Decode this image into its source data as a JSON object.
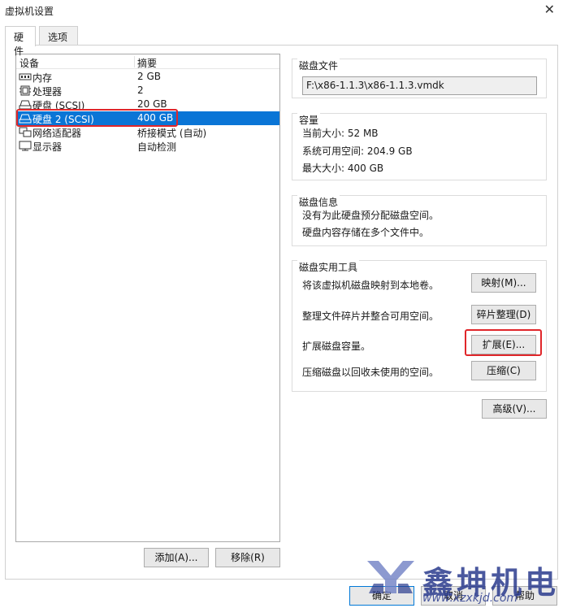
{
  "window": {
    "title": "虚拟机设置"
  },
  "tabs": [
    {
      "label": "硬件"
    },
    {
      "label": "选项"
    }
  ],
  "device_list": {
    "col_device": "设备",
    "col_summary": "摘要",
    "rows": [
      {
        "name": "内存",
        "summary": "2 GB",
        "icon": "memory-icon"
      },
      {
        "name": "处理器",
        "summary": "2",
        "icon": "cpu-icon"
      },
      {
        "name": "硬盘 (SCSI)",
        "summary": "20 GB",
        "icon": "harddisk-icon"
      },
      {
        "name": "硬盘 2 (SCSI)",
        "summary": "400 GB",
        "icon": "harddisk-icon",
        "selected": true
      },
      {
        "name": "网络适配器",
        "summary": "桥接模式 (自动)",
        "icon": "network-icon"
      },
      {
        "name": "显示器",
        "summary": "自动检测",
        "icon": "monitor-icon"
      }
    ]
  },
  "left_buttons": {
    "add": "添加(A)...",
    "remove": "移除(R)"
  },
  "disk_file": {
    "label": "磁盘文件",
    "path": "F:\\x86-1.1.3\\x86-1.1.3.vmdk"
  },
  "capacity": {
    "label": "容量",
    "current": "当前大小: 52 MB",
    "available": "系统可用空间: 204.9 GB",
    "max": "最大大小: 400 GB"
  },
  "disk_info": {
    "label": "磁盘信息",
    "line1": "没有为此硬盘预分配磁盘空间。",
    "line2": "硬盘内容存储在多个文件中。"
  },
  "disk_tools": {
    "label": "磁盘实用工具",
    "map_text": "将该虚拟机磁盘映射到本地卷。",
    "map_btn": "映射(M)...",
    "defrag_text": "整理文件碎片并整合可用空间。",
    "defrag_btn": "碎片整理(D)",
    "expand_text": "扩展磁盘容量。",
    "expand_btn": "扩展(E)...",
    "compact_text": "压缩磁盘以回收未使用的空间。",
    "compact_btn": "压缩(C)"
  },
  "advanced_btn": "高级(V)...",
  "footer": {
    "ok": "确定",
    "cancel": "取消",
    "help": "帮助"
  },
  "watermark": {
    "name": "鑫坤机电",
    "url": "www.xzxkjd.com"
  },
  "colors": {
    "selection": "#0a75d6",
    "highlight": "#e0262a",
    "brand": "#2b3c8e"
  }
}
